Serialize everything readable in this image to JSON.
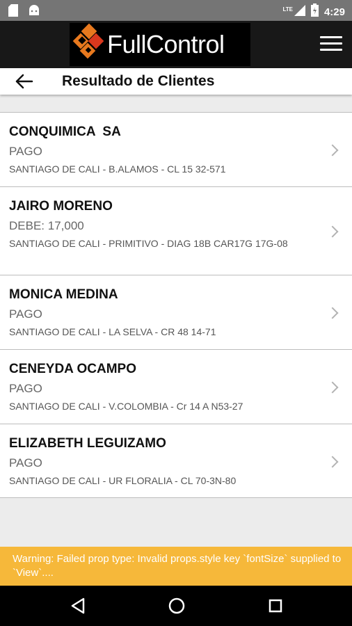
{
  "status_bar": {
    "network_label": "LTE",
    "time": "4:29",
    "icons": [
      "sd-card-icon",
      "android-icon",
      "signal-icon",
      "battery-charging-icon"
    ]
  },
  "app_bar": {
    "logo_text": "FullControl",
    "logo_colors": [
      "#e8791e",
      "#d9381e"
    ],
    "menu_icon": "hamburger-menu-icon"
  },
  "subheader": {
    "title": "Resultado de Clientes",
    "back_icon": "arrow-left-icon"
  },
  "clients": [
    {
      "name": "CONQUIMICA  SA",
      "status": "PAGO",
      "address": "SANTIAGO DE CALI - B.ALAMOS - CL 15 32-571"
    },
    {
      "name": "JAIRO MORENO",
      "status": "DEBE: 17,000",
      "address": "SANTIAGO DE CALI - PRIMITIVO - DIAG 18B CAR17G 17G-08"
    },
    {
      "name": "MONICA MEDINA",
      "status": "PAGO",
      "address": "SANTIAGO DE CALI - LA SELVA - CR 48 14-71"
    },
    {
      "name": "CENEYDA OCAMPO",
      "status": "PAGO",
      "address": "SANTIAGO DE CALI - V.COLOMBIA - Cr 14 A  N53-27"
    },
    {
      "name": "ELIZABETH LEGUIZAMO",
      "status": "PAGO",
      "address": "SANTIAGO DE CALI - UR FLORALIA - CL 70-3N-80"
    }
  ],
  "warning": {
    "text": "Warning: Failed prop type: Invalid props.style key `fontSize` supplied to `View`....",
    "color": "#f6b83a"
  },
  "nav_bar": {
    "icons": [
      "back-triangle-icon",
      "home-circle-icon",
      "recents-square-icon"
    ]
  }
}
